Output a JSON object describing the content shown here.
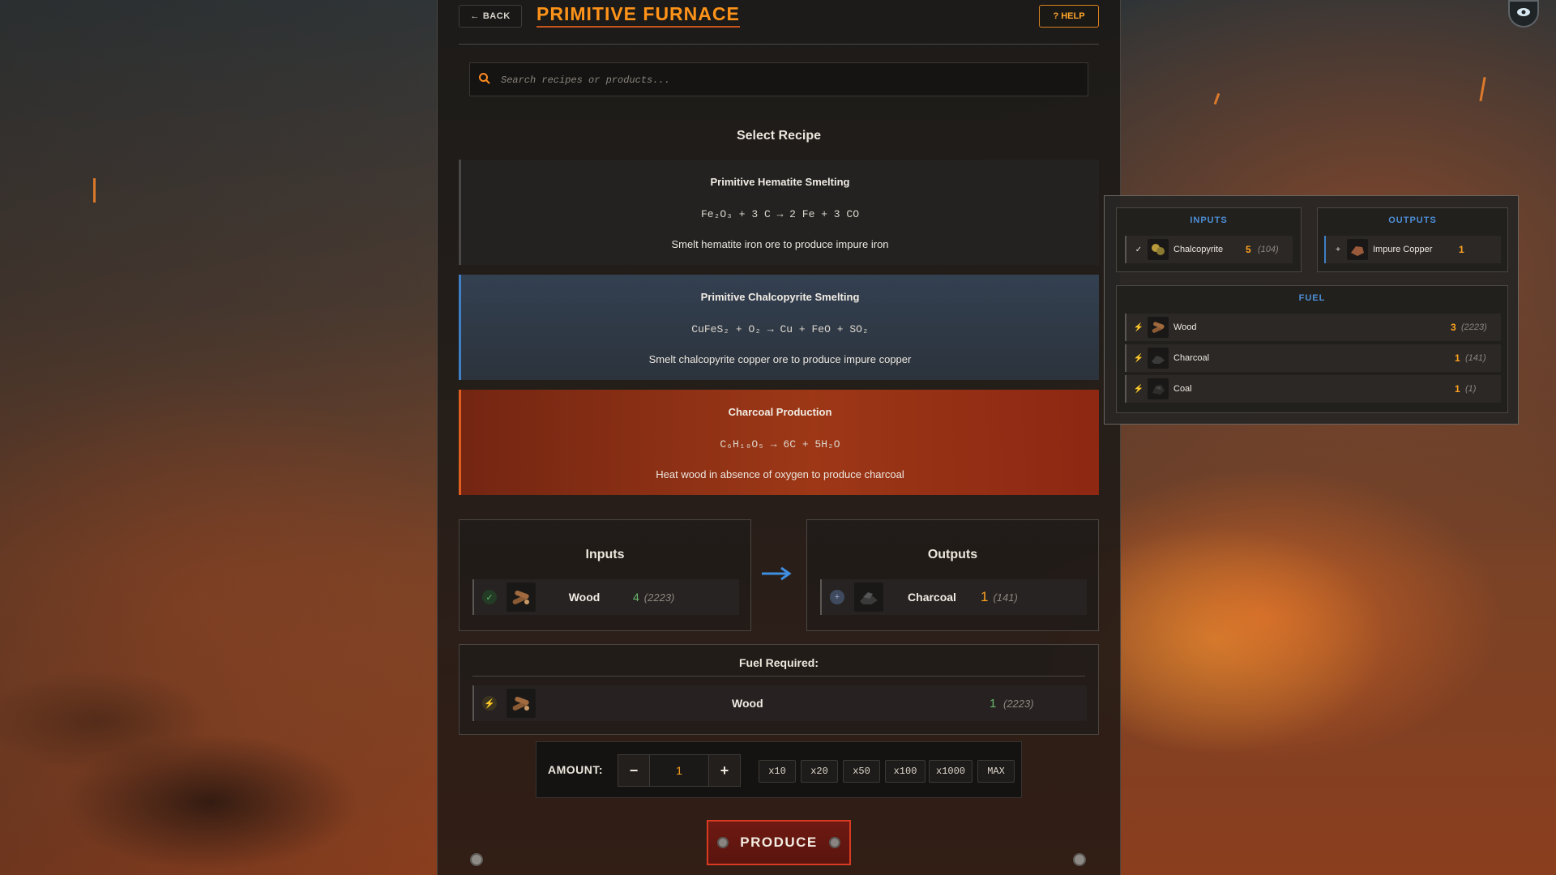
{
  "header": {
    "back_label": "BACK",
    "title": "PRIMITIVE FURNACE",
    "help_label": "HELP"
  },
  "search": {
    "placeholder": "Search recipes or products..."
  },
  "recipe_section_title": "Select Recipe",
  "recipes": [
    {
      "name": "Primitive Hematite Smelting",
      "formula": "Fe₂O₃ + 3 C → 2 Fe + 3 CO",
      "description": "Smelt hematite iron ore to produce impure iron"
    },
    {
      "name": "Primitive Chalcopyrite Smelting",
      "formula": "CuFeS₂ + O₂ → Cu + FeO + SO₂",
      "description": "Smelt chalcopyrite copper ore to produce impure copper"
    },
    {
      "name": "Charcoal Production",
      "formula": "C₆H₁₀O₅ → 6C + 5H₂O",
      "description": "Heat wood in absence of oxygen to produce charcoal"
    }
  ],
  "inputs": {
    "heading": "Inputs",
    "item": {
      "name": "Wood",
      "amount": "4",
      "have": "(2223)"
    }
  },
  "outputs": {
    "heading": "Outputs",
    "item": {
      "name": "Charcoal",
      "amount": "1",
      "have": "(141)"
    }
  },
  "fuel": {
    "heading": "Fuel Required:",
    "item": {
      "name": "Wood",
      "amount": "1",
      "have": "(2223)"
    }
  },
  "amount": {
    "label": "AMOUNT:",
    "minus": "−",
    "value": "1",
    "plus": "+",
    "multipliers": [
      "x10",
      "x20",
      "x50",
      "x100",
      "x1000",
      "MAX"
    ]
  },
  "produce_label": "PRODUCE",
  "preview": {
    "inputs_heading": "INPUTS",
    "outputs_heading": "OUTPUTS",
    "fuel_heading": "FUEL",
    "input": {
      "name": "Chalcopyrite",
      "amount": "5",
      "have": "(104)"
    },
    "output": {
      "name": "Impure Copper",
      "amount": "1"
    },
    "fuels": [
      {
        "name": "Wood",
        "amount": "3",
        "have": "(2223)"
      },
      {
        "name": "Charcoal",
        "amount": "1",
        "have": "(141)"
      },
      {
        "name": "Coal",
        "amount": "1",
        "have": "(1)"
      }
    ]
  },
  "colors": {
    "accent": "#ff9319",
    "selected_recipe": "#e05f1e",
    "hover_recipe": "#3f7fc6",
    "produce_border": "#d83a22"
  },
  "icons": {
    "search": "search-icon",
    "check": "check-icon",
    "bolt": "lightning-icon",
    "arrow": "arrow-right-icon",
    "eye": "eye-icon"
  }
}
